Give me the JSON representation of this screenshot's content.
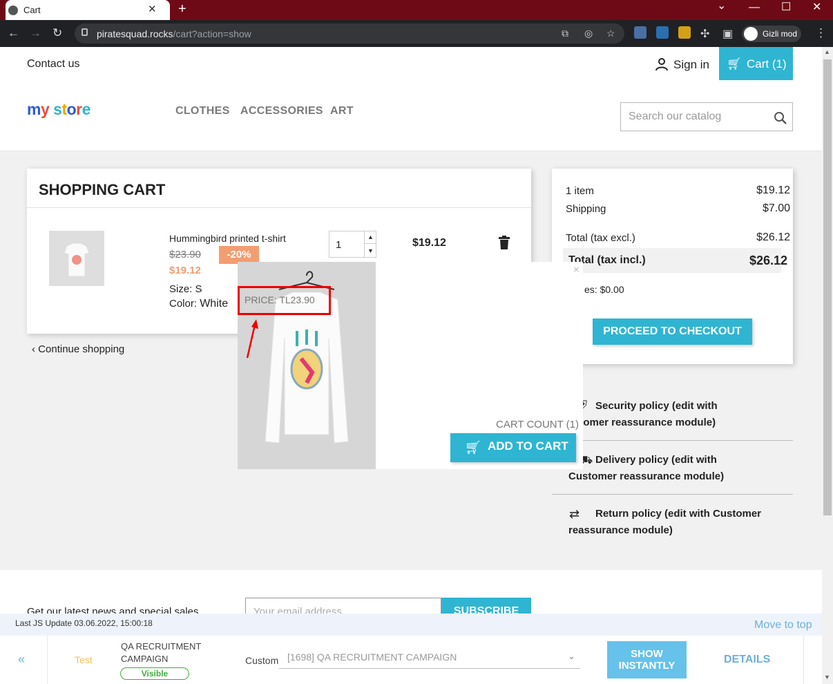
{
  "browser": {
    "tab_title": "Cart",
    "url_host": "piratesquad.rocks",
    "url_path": "/cart?action=show",
    "incognito_label": "Gizli mod"
  },
  "topbar": {
    "contact": "Contact us",
    "sign_in": "Sign in",
    "cart_label": "Cart (1)"
  },
  "header": {
    "logo_text": "my store",
    "menu": [
      "CLOTHES",
      "ACCESSORIES",
      "ART"
    ],
    "search_placeholder": "Search our catalog"
  },
  "cart": {
    "title": "SHOPPING CART",
    "product": {
      "name": "Hummingbird printed t-shirt",
      "old_price": "$23.90",
      "discount": "-20%",
      "price": "$19.12",
      "size_label": "Size:",
      "size_value": "S",
      "color_label": "Color:",
      "color_value": "White",
      "quantity": "1",
      "line_total": "$19.12"
    },
    "continue_label": "Continue shopping"
  },
  "summary": {
    "items_label": "1 item",
    "items_value": "$19.12",
    "shipping_label": "Shipping",
    "shipping_value": "$7.00",
    "total_excl_label": "Total (tax excl.)",
    "total_excl_value": "$26.12",
    "total_incl_label": "Total (tax incl.)",
    "total_incl_value": "$26.12",
    "taxes": "es: $0.00",
    "checkout_label": "PROCEED TO CHECKOUT"
  },
  "reassurance": [
    {
      "icon": "shield-icon",
      "text": "Security policy (edit with Customer reassurance module)"
    },
    {
      "icon": "truck-icon",
      "text": "Delivery policy (edit with Customer reassurance module)"
    },
    {
      "icon": "swap-icon",
      "text": "Return policy (edit with Customer reassurance module)"
    }
  ],
  "reassure_visible": {
    "security_l1": "Security policy (edit with",
    "security_l2": "stomer reassurance module)",
    "delivery_l1": "Delivery policy (edit with",
    "delivery_l2": "Customer reassurance module)",
    "return_l1": "Return policy (edit with Customer",
    "return_l2": "reassurance module)"
  },
  "popup": {
    "price_label": "PRICE: TL23.90",
    "cart_count": "CART COUNT (1)",
    "add_to_cart": "ADD TO CART",
    "close": "×"
  },
  "footer": {
    "newsletter_text": "Get our latest news and special sales",
    "email_placeholder": "Your email address",
    "subscribe": "SUBSCRIBE"
  },
  "widget": {
    "js_update": "Last JS Update 03.06.2022, 15:00:18",
    "move_to_top": "Move to top",
    "back": "«",
    "test": "Test",
    "campaign": "QA RECRUITMENT CAMPAIGN",
    "status": "Visible",
    "custom_label": "Custom",
    "select_value": "[1698] QA RECRUITMENT CAMPAIGN",
    "show_instantly": "SHOW INSTANTLY",
    "details": "DETAILS"
  },
  "colors": {
    "accent": "#2fb5d2",
    "discount": "#f39d72",
    "tabbar": "#6e0a16",
    "highlight": "#e00000"
  }
}
